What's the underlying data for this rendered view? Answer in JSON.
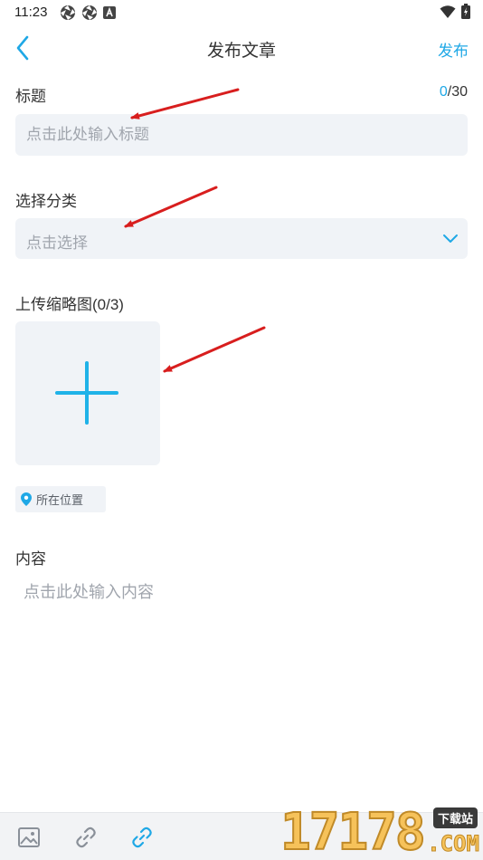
{
  "status_bar": {
    "time": "11:23",
    "left_icons": [
      "aperture-icon",
      "aperture-icon",
      "font-a-icon"
    ],
    "right_icons": [
      "wifi-icon",
      "battery-icon"
    ]
  },
  "header": {
    "title": "发布文章",
    "publish_label": "发布",
    "back_icon": "chevron-left-icon"
  },
  "title_field": {
    "label": "标题",
    "counter_current": "0",
    "counter_total": "/30",
    "placeholder": "点击此处输入标题"
  },
  "category_field": {
    "label": "选择分类",
    "placeholder": "点击选择",
    "icon": "chevron-down-icon"
  },
  "thumbnail": {
    "label": "上传缩略图(0/3)",
    "icon": "plus-icon"
  },
  "location": {
    "label": "所在位置",
    "icon": "location-pin-icon"
  },
  "content_field": {
    "label": "内容",
    "placeholder": "点击此处输入内容"
  },
  "toolbar": {
    "items": [
      "image-icon",
      "link-icon",
      "link-icon"
    ]
  },
  "watermark": {
    "digits": "17178",
    "tag": "下载站",
    "suffix": ".COM"
  },
  "colors": {
    "accent": "#1fa8e6",
    "field_bg": "#f0f3f7",
    "placeholder": "#a0a5ad",
    "annotation_arrow": "#d81e1e"
  }
}
